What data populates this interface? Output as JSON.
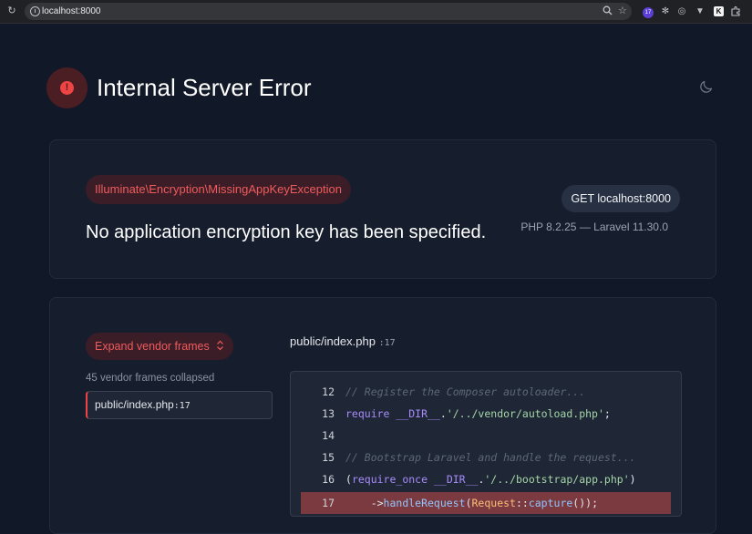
{
  "browser": {
    "url": "localhost:8000",
    "extension_badge": "17",
    "extension_k": "K"
  },
  "header": {
    "title": "Internal Server Error",
    "error_icon": "exclamation-icon",
    "theme_icon": "moon-icon"
  },
  "exception": {
    "class": "Illuminate\\Encryption\\MissingAppKeyException",
    "message": "No application encryption key has been specified.",
    "request": "GET localhost:8000",
    "versions": "PHP 8.2.25 — Laravel 11.30.0"
  },
  "trace": {
    "vendor_button": "Expand vendor frames",
    "vendor_icon": "chevron-up-down-icon",
    "collapsed_text": "45 vendor frames collapsed",
    "frames": [
      {
        "file": "public/index.php",
        "line": "17"
      }
    ],
    "file": "public/index.php",
    "file_line": ":17"
  },
  "code": [
    {
      "num": "12",
      "text": "// Register the Composer autoloader..."
    },
    {
      "num": "13",
      "text": "require __DIR__.'/../vendor/autoload.php';"
    },
    {
      "num": "14",
      "text": ""
    },
    {
      "num": "15",
      "text": "// Bootstrap Laravel and handle the request..."
    },
    {
      "num": "16",
      "text": "(require_once __DIR__.'/../bootstrap/app.php')"
    },
    {
      "num": "17",
      "text": "    ->handleRequest(Request::capture());"
    }
  ],
  "colors": {
    "background": "#111827",
    "card": "#161e2d",
    "accent_red": "#ef4444",
    "highlight": "#7a3a40"
  }
}
